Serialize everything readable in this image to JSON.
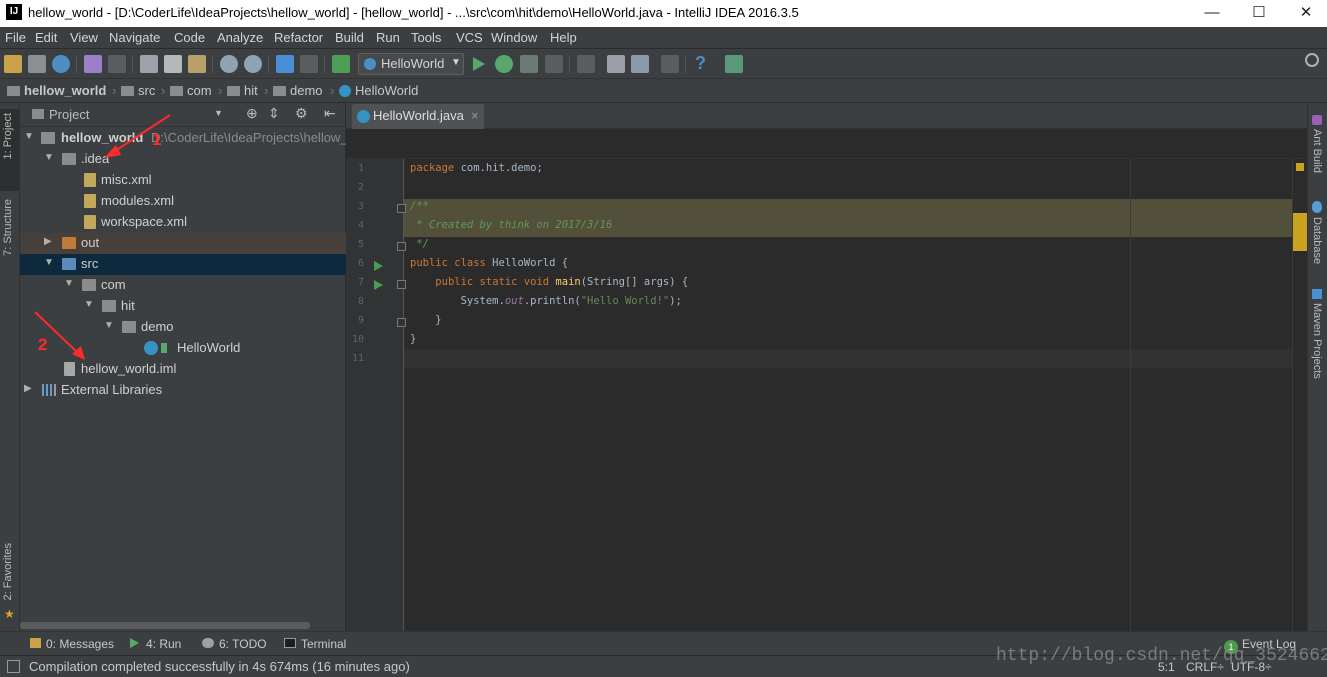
{
  "window": {
    "title": "hellow_world - [D:\\CoderLife\\IdeaProjects\\hellow_world] - [hellow_world] - ...\\src\\com\\hit\\demo\\HelloWorld.java - IntelliJ IDEA 2016.3.5",
    "app_icon_text": "IJ",
    "controls": {
      "minimize": "—",
      "maximize": "☐",
      "close": "✕"
    }
  },
  "menu": [
    "File",
    "Edit",
    "View",
    "Navigate",
    "Code",
    "Analyze",
    "Refactor",
    "Build",
    "Run",
    "Tools",
    "VCS",
    "Window",
    "Help"
  ],
  "toolbar": {
    "run_config": "HelloWorld",
    "help": "?"
  },
  "breadcrumbs": [
    "hellow_world",
    "src",
    "com",
    "hit",
    "demo",
    "HelloWorld"
  ],
  "left_tool_tabs": [
    "1: Project",
    "7: Structure",
    "2: Favorites"
  ],
  "right_tool_tabs": [
    "Ant Build",
    "Database",
    "Maven Projects"
  ],
  "project": {
    "header": "Project",
    "tree": [
      {
        "label": "hellow_world",
        "hint": "D:\\CoderLife\\IdeaProjects\\hellow_"
      },
      {
        "label": ".idea"
      },
      {
        "label": "misc.xml"
      },
      {
        "label": "modules.xml"
      },
      {
        "label": "workspace.xml"
      },
      {
        "label": "out"
      },
      {
        "label": "src"
      },
      {
        "label": "com"
      },
      {
        "label": "hit"
      },
      {
        "label": "demo"
      },
      {
        "label": "HelloWorld"
      },
      {
        "label": "hellow_world.iml"
      },
      {
        "label": "External Libraries"
      }
    ]
  },
  "editor": {
    "tab": "HelloWorld.java",
    "tab_close": "×",
    "line_numbers": [
      "1",
      "2",
      "3",
      "4",
      "5",
      "6",
      "7",
      "8",
      "9",
      "10",
      "11"
    ],
    "code": {
      "l1_kw": "package",
      "l1_rest": " com.hit.demo;",
      "l3": "/**",
      "l4": " * Created by think on 2017/3/16",
      "l5": " */",
      "l6_kw": "public class",
      "l6_rest": " HelloWorld {",
      "l7_kw": "public static void",
      "l7_fn": "main",
      "l7_rest": "(String[] args) {",
      "l8_a": "System.",
      "l8_static": "out",
      "l8_b": ".println(",
      "l8_str": "\"Hello World!\"",
      "l8_c": ");",
      "l9": "}",
      "l10": "}"
    }
  },
  "bottom_tabs": [
    "0: Messages",
    "4: Run",
    "6: TODO",
    "Terminal"
  ],
  "event_log": {
    "count": "1",
    "label": "Event Log"
  },
  "status": {
    "message": "Compilation completed successfully in 4s 674ms (16 minutes ago)",
    "position": "5:1",
    "line_sep": "CRLF÷",
    "encoding": "UTF-8÷"
  },
  "annotations": [
    "1",
    "2"
  ],
  "watermark": "http://blog.csdn.net/qq_35246620",
  "colors": {
    "keyword": "#cc7832",
    "comment": "#629755",
    "string": "#6a8759",
    "function": "#ffc66d",
    "annotation": "#ff2a2a"
  }
}
